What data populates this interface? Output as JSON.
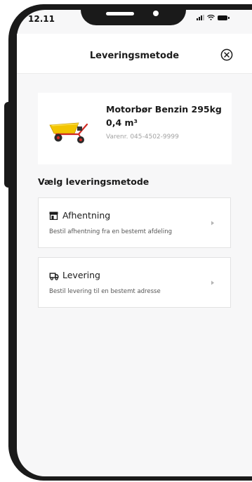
{
  "status_bar": {
    "time": "12.11",
    "icons": [
      "signal-icon",
      "wifi-icon",
      "battery-icon"
    ]
  },
  "header": {
    "title": "Leveringsmetode",
    "close_icon": "close-icon"
  },
  "product": {
    "name": "Motorbør Benzin 295kg 0,4 m³",
    "sku": "Varenr. 045-4502-9999",
    "image": "wheelbarrow-image"
  },
  "section": {
    "title": "Vælg leveringsmetode"
  },
  "options": [
    {
      "icon": "store-icon",
      "title": "Afhentning",
      "description": "Bestil afhentning fra en bestemt afdeling"
    },
    {
      "icon": "truck-icon",
      "title": "Levering",
      "description": "Bestil levering til en bestemt adresse"
    }
  ],
  "colors": {
    "background": "#f7f7f8",
    "card": "#ffffff",
    "text": "#1a1a1a",
    "muted": "#a2a2a2",
    "product_yellow": "#f2c400",
    "product_red": "#d02a24"
  }
}
